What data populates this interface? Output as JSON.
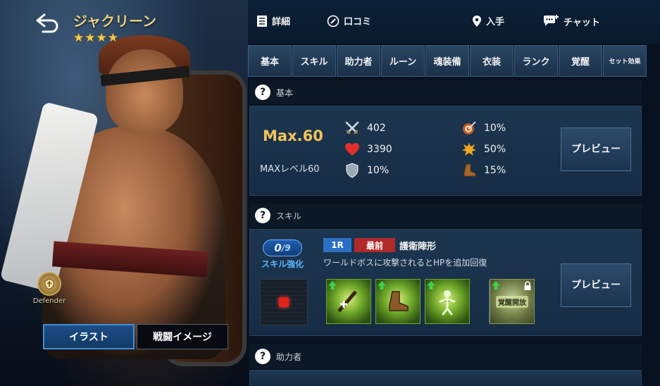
{
  "character": {
    "name": "ジャクリーン",
    "stars": [
      "★",
      "★",
      "★",
      "★"
    ],
    "class_label": "Defender"
  },
  "art_buttons": {
    "illust": "イラスト",
    "battle_image": "戦闘イメージ"
  },
  "topbar": {
    "details": "詳細",
    "reviews": "口コミ",
    "obtain": "入手",
    "chat": "チャット"
  },
  "tabs": [
    {
      "label": "基本"
    },
    {
      "label": "スキル"
    },
    {
      "label": "助力者"
    },
    {
      "label": "ルーン"
    },
    {
      "label": "魂装備"
    },
    {
      "label": "衣装"
    },
    {
      "label": "ランク"
    },
    {
      "label": "覚醒"
    },
    {
      "label": "セット効果"
    }
  ],
  "basic": {
    "header": "基本",
    "max_level": "Max.60",
    "max_level_sub": "MAXレベル60",
    "stats": {
      "attack": "402",
      "hp": "3390",
      "defense": "10%",
      "accuracy": "10%",
      "crit": "50%",
      "speed": "15%"
    },
    "preview_label": "プレビュー"
  },
  "skill": {
    "header": "スキル",
    "count_current": "0",
    "count_sep": "/",
    "count_max": "9",
    "enhance_label": "スキル強化",
    "round_tag": "1R",
    "position_tag": "最前",
    "name": "護衛陣形",
    "description": "ワールドボスに攻撃されるとHPを追加回復",
    "awaken_label": "覚醒開放",
    "preview_label": "プレビュー"
  },
  "helper": {
    "header": "助力者"
  },
  "colors": {
    "accent_gold": "#f2c45c",
    "tab_bg": "#2a4663",
    "tag_blue": "#2b6fc4",
    "tag_red": "#b02a2a"
  }
}
